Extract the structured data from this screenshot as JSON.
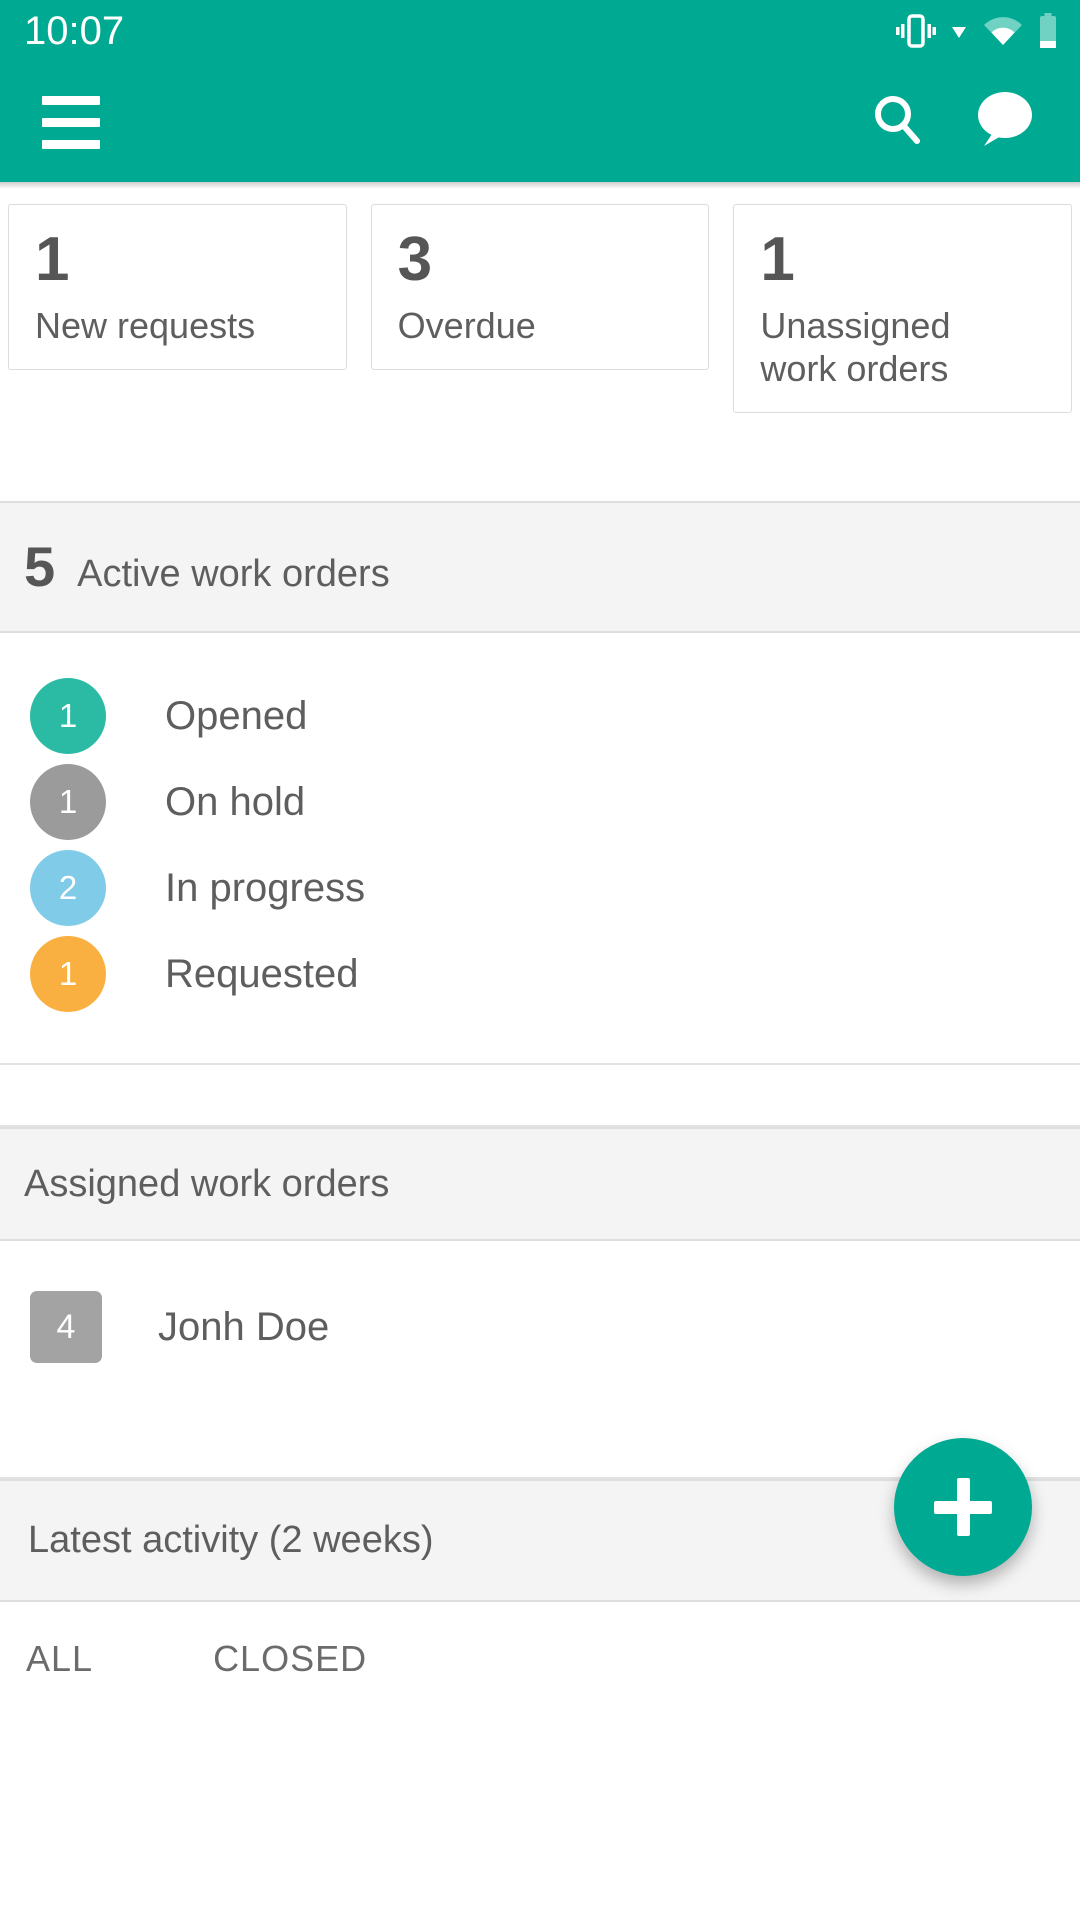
{
  "status_bar": {
    "time": "10:07",
    "icons": [
      "vibrate-icon",
      "dropdown-triangle-icon",
      "wifi-icon",
      "battery-icon"
    ]
  },
  "app_bar": {
    "menu_icon": "hamburger-menu-icon",
    "search_icon": "search-icon",
    "chat_icon": "chat-bubble-icon",
    "brand_color": "#00a991"
  },
  "stat_cards": [
    {
      "count": "1",
      "label": "New requests"
    },
    {
      "count": "3",
      "label": "Overdue"
    },
    {
      "count": "1",
      "label": "Unassigned\nwork orders"
    }
  ],
  "active_section": {
    "count": "5",
    "title": "Active work orders",
    "statuses": [
      {
        "count": "1",
        "label": "Opened",
        "color": "#2bbba4"
      },
      {
        "count": "1",
        "label": "On hold",
        "color": "#9b9b9b"
      },
      {
        "count": "2",
        "label": "In progress",
        "color": "#7fcbe8"
      },
      {
        "count": "1",
        "label": "Requested",
        "color": "#f9b040"
      }
    ]
  },
  "assigned_section": {
    "title": "Assigned work orders",
    "rows": [
      {
        "count": "4",
        "name": "Jonh Doe",
        "badge_color": "#a3a3a3"
      }
    ]
  },
  "activity_section": {
    "title": "Latest activity (2 weeks)",
    "tabs": [
      {
        "label": "ALL"
      },
      {
        "label": "CLOSED"
      }
    ]
  },
  "fab": {
    "name": "add-button",
    "icon": "plus-icon",
    "color": "#00a991"
  }
}
